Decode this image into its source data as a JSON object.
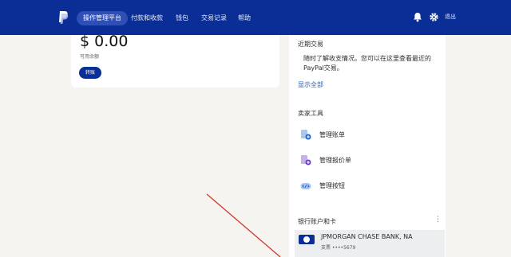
{
  "nav": {
    "items": [
      {
        "label": "操作管理平台",
        "active": true
      },
      {
        "label": "付款和收款",
        "active": false
      },
      {
        "label": "钱包",
        "active": false
      },
      {
        "label": "交易记录",
        "active": false
      },
      {
        "label": "帮助",
        "active": false
      }
    ],
    "logout_label": "退出"
  },
  "balance": {
    "amount": "$ 0.00",
    "label": "可用余额",
    "transfer_label": "转账"
  },
  "recent": {
    "heading": "近期交易",
    "description": "随时了解收支情况。您可以在这里查看最近的PayPal交易。",
    "show_all": "显示全部"
  },
  "seller_tools": {
    "heading": "卖家工具",
    "items": [
      {
        "label": "管理账单",
        "icon": "invoice-icon"
      },
      {
        "label": "管理报价单",
        "icon": "quote-icon"
      },
      {
        "label": "管理按钮",
        "icon": "button-code-icon"
      }
    ]
  },
  "bank": {
    "heading": "银行账户和卡",
    "name": "JPMORGAN CHASE BANK, NA",
    "sub": "支票 ••••5679"
  },
  "colors": {
    "nav_bg": "#0a2e96",
    "link": "#1d63c9",
    "annotation": "#d2372b"
  }
}
